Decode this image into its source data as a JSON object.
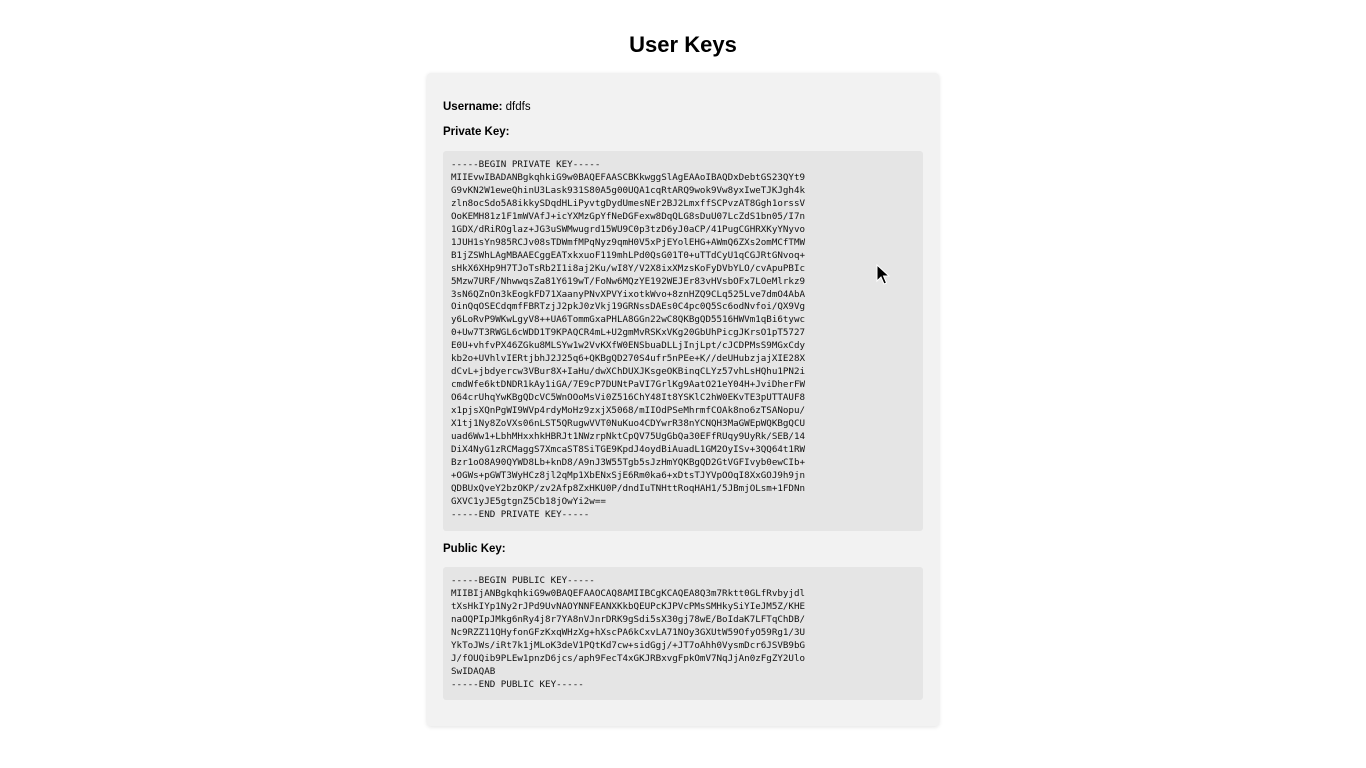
{
  "page": {
    "title": "User Keys"
  },
  "user": {
    "username_label": "Username:",
    "username_value": "dfdfs"
  },
  "private_key": {
    "label": "Private Key:",
    "text": "-----BEGIN PRIVATE KEY-----\nMIIEvwIBADANBgkqhkiG9w0BAQEFAASCBKkwggSlAgEAAoIBAQDxDebtGS23QYt9\nG9vKN2W1eweQhinU3Lask931S80A5g00UQA1cqRtARQ9wok9Vw8yxIweTJKJgh4k\nzln8ocSdo5A8ikkySDqdHLiPyvtgDydUmesNEr2BJ2LmxffSCPvzAT8Ggh1orssV\nOoKEMH81z1F1mWVAfJ+icYXMzGpYfNeDGFexw8DqQLG8sDuU07LcZdS1bn05/I7n\n1GDX/dRiROglaz+JG3uSWMwugrd15WU9C0p3tzD6yJ0aCP/41PugCGHRXKyYNyvo\n1JUH1sYn985RCJv08sTDWmfMPqNyz9qmH0V5xPjEYolEHG+AWmQ6ZXs2omMCfTMW\nB1jZSWhLAgMBAAECggEATxkxuoF119mhLPd0QsG01T0+uTTdCyU1qCGJRtGNvoq+\nsHkX6XHp9H7TJoTsRb2I1i8aj2Ku/wI8Y/V2X8ixXMzsKoFyDVbYLO/cvApuPBIc\n5Mzw7URF/NhwwqsZa81Y619wT/FoNw6MQzYE192WEJEr83vHVsbOFx7LOeMlrkz9\n3sN6QZnOn3kEogkFD71XaanyPNvXPVYixotkWvo+8znHZQ9CLq525Lve7dmO4AbA\nOinQqOSECdqmfFBRTzjJ2pkJ0zVkj19GRNssDAEs0C4pc0Q5Sc6odNvfoi/QX9Vg\ny6LoRvP9WKwLgyV8++UA6TommGxaPHLA8GGn22wC8QKBgQD5516HWVm1qBi6tywc\n0+Uw7T3RWGL6cWDD1T9KPAQCR4mL+U2gmMvRSKxVKg20GbUhPicgJKrsO1pT5727\nE0U+vhfvPX46ZGku8MLSYw1w2VvKXfW0ENSbuaDLLjInjLpt/cJCDPMsS9MGxCdy\nkb2o+UVhlvIERtjbhJ2J25q6+QKBgQD270S4ufr5nPEe+K//deUHubzjajXIE28X\ndCvL+jbdyercw3VBur8X+IaHu/dwXChDUXJKsgeOKBinqCLYz57vhLsHQhu1PN2i\ncmdWfe6ktDNDR1kAy1iGA/7E9cP7DUNtPaVI7GrlKg9AatO21eY04H+JviDherFW\nO64crUhqYwKBgQDcVC5WnOOoMsVi0Z516ChY48It8YSKlC2hW0EKvTE3pUTTAUF8\nx1pjsXQnPgWI9WVp4rdyMoHz9zxjX5068/mIIOdPSeMhrmfCOAk8no6zTSANopu/\nX1tj1Ny8ZoVXs06nLST5QRugwVVT0NuKuo4CDYwrR38nYCNQH3MaGWEpWQKBgQCU\nuad6Ww1+LbhMHxxhkHBRJt1NWzrpNktCpQV75UgGbQa30EFfRUqy9UyRk/SEB/14\nDiX4NyG1zRCMaggS7XmcaST8SiTGE9KpdJ4oydBiAuadL1GM2OyISv+3QQ64t1RW\nBzr1oO8A90QYWD8Lb+knD8/A9nJ3W55Tgb5sJzHmYQKBgQD2GtVGFIvyb0ewCIb+\n+OGWs+pGWT3WyHCz8jl2qMp1XbENxSjE6Rm0ka6+xDtsTJYVpOOqI8XxGOJ9h9jn\nQDBUxQveY2bzOKP/zv2Afp8ZxHKU0P/dndIuTNHttRoqHAH1/5JBmjOLsm+1FDNn\nGXVC1yJE5gtgnZ5Cb18jOwYi2w==\n-----END PRIVATE KEY-----"
  },
  "public_key": {
    "label": "Public Key:",
    "text": "-----BEGIN PUBLIC KEY-----\nMIIBIjANBgkqhkiG9w0BAQEFAAOCAQ8AMIIBCgKCAQEA8Q3m7Rktt0GLfRvbyjdl\ntXsHkIYp1Ny2rJPd9UvNAOYNNFEANXKkbQEUPcKJPVcPMsSMHkySiYIeJM5Z/KHE\nnaOQPIpJMkg6nRy4j8r7YA8nVJnrDRK9gSdi5sX30gj78wE/BoIdaK7LFTqChDB/\nNc9RZZ11QHyfonGFzKxqWHzXg+hXscPA6kCxvLA71NOy3GXUtW59OfyO59Rg1/3U\nYkToJWs/iRt7k1jMLoK3deV1PQtKd7cw+sidGgj/+JT7oAhh0VysmDcr6JSVB9bG\nJ/fOUQib9PLEw1pnzD6jcs/aph9FecT4xGKJRBxvgFpkOmV7NqJjAn0zFgZY2Ulo\nSwIDAQAB\n-----END PUBLIC KEY-----"
  },
  "icons": {
    "cursor": "mouse-pointer-icon"
  }
}
